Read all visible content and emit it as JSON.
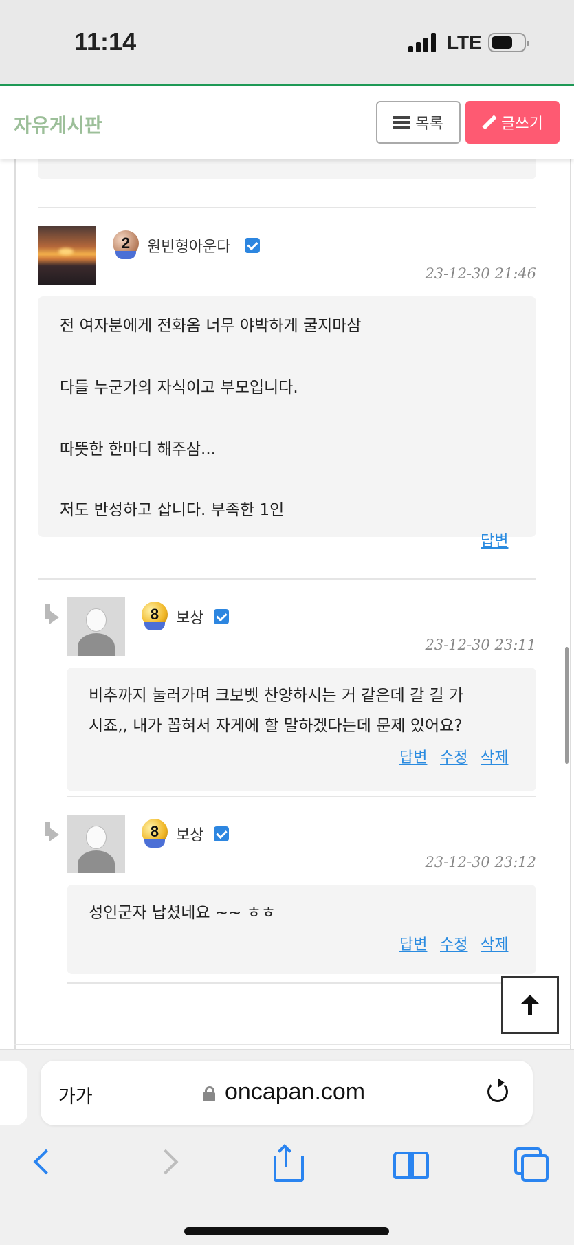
{
  "status_bar": {
    "time": "11:14",
    "network": "LTE"
  },
  "header": {
    "title": "자유게시판",
    "list_label": "목록",
    "write_label": "글쓰기"
  },
  "comments": [
    {
      "id": "prev",
      "actions": [
        "답변"
      ]
    },
    {
      "id": "c1",
      "username": "원빈형아운다",
      "level": "2",
      "date": "23-12-30 21:46",
      "lines": [
        "전 여자분에게 전화옴 너무 야박하게 굴지마삼",
        "다들 누군가의 자식이고 부모입니다.",
        "따뜻한 한마디 해주삼...",
        "저도 반성하고 삽니다. 부족한 1인"
      ],
      "actions": [
        "답변"
      ]
    },
    {
      "id": "c2",
      "username": "보상",
      "level": "8",
      "date": "23-12-30 23:11",
      "lines": [
        "비추까지 눌러가며 크보벳 찬양하시는 거 같은데 갈 길 가",
        "시죠,, 내가 꼽혀서 자게에 할 말하겠다는데 문제 있어요?"
      ],
      "actions": [
        "답변",
        "수정",
        "삭제"
      ]
    },
    {
      "id": "c3",
      "username": "보상",
      "level": "8",
      "date": "23-12-30 23:12",
      "lines": [
        "성인군자 납셨네요 ~~ ㅎㅎ"
      ],
      "actions": [
        "답변",
        "수정",
        "삭제"
      ]
    }
  ],
  "browser": {
    "text_size_label": "가가",
    "url": "oncapan.com"
  },
  "colors": {
    "accent_green": "#1f9a57",
    "write_button": "#fe5a72",
    "link_blue": "#2a8be0",
    "title_green": "#9cbf99"
  }
}
